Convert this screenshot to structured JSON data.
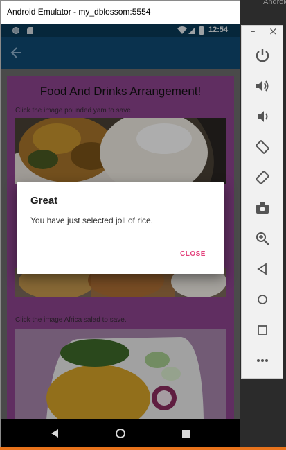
{
  "host": {
    "label": "Android"
  },
  "window": {
    "title": "Android Emulator - my_dblossom:5554"
  },
  "statusbar": {
    "time": "12:54"
  },
  "app": {
    "heading": "Food And Drinks Arrangement!",
    "hint_1": "Click the image pounded yam to save.",
    "hint_3": "Click the image Africa salad to save."
  },
  "dialog": {
    "title": "Great",
    "message": "You have just selected joll of rice.",
    "close_label": "CLOSE"
  },
  "toolbar": {
    "minimize": "–",
    "close": "×",
    "icons": [
      "power-icon",
      "volume-up-icon",
      "volume-down-icon",
      "rotate-left-icon",
      "rotate-right-icon",
      "camera-icon",
      "zoom-icon",
      "back-icon",
      "home-icon",
      "overview-icon",
      "more-icon"
    ]
  },
  "colors": {
    "appbar": "#0f4a74",
    "card": "#8e4590",
    "accent": "#e3407b"
  }
}
